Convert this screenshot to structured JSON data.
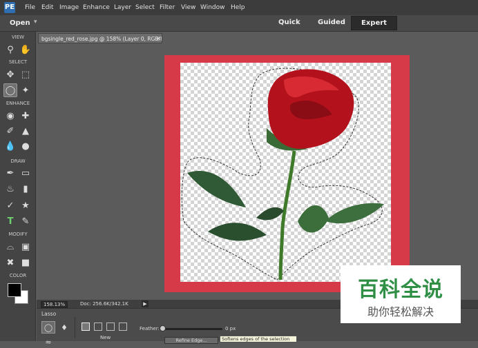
{
  "menubar": {
    "logo": "PE",
    "items": [
      "File",
      "Edit",
      "Image",
      "Enhance",
      "Layer",
      "Select",
      "Filter",
      "View",
      "Window",
      "Help"
    ]
  },
  "modebar": {
    "open_label": "Open",
    "modes": [
      "Quick",
      "Guided",
      "Expert"
    ],
    "active_mode": "Expert"
  },
  "toolbox": {
    "sections": [
      "VIEW",
      "SELECT",
      "ENHANCE",
      "DRAW",
      "MODIFY",
      "COLOR"
    ],
    "tools": {
      "zoom": "zoom-icon",
      "hand": "hand-icon",
      "move": "move-icon",
      "marquee": "marquee-icon",
      "lasso": "lasso-icon",
      "quick_select": "quick-selection-icon",
      "red_eye": "red-eye-icon",
      "spot_heal": "spot-healing-icon",
      "smart_brush": "smart-brush-icon",
      "clone": "clone-stamp-icon",
      "blur": "blur-icon",
      "sponge": "sponge-icon",
      "brush": "brush-icon",
      "eraser": "eraser-icon",
      "paint_bucket": "paint-bucket-icon",
      "gradient": "gradient-icon",
      "eyedropper": "eyedropper-icon",
      "custom_shape": "custom-shape-icon",
      "type": "type-icon",
      "pencil": "pencil-icon",
      "crop": "crop-icon",
      "recompose": "recompose-icon",
      "straighten": "straighten-icon",
      "content_move": "content-aware-move-icon"
    },
    "foreground_color": "#000000",
    "background_color": "#ffffff"
  },
  "document": {
    "tab_title": "bgsingle_red_rose.jpg @ 158% (Layer 0, RGB/8) *",
    "close_glyph": "×",
    "frame_color": "#d63a48"
  },
  "statusbar": {
    "zoom": "158.13%",
    "doc_info": "Doc: 256.6K/342.1K",
    "arrow": "▶"
  },
  "options": {
    "tool_name": "Lasso",
    "new_label": "New",
    "feather_label": "Feather:",
    "feather_value": "0 px",
    "feather_fraction": 0,
    "tooltip": "Softens edges of the selection",
    "refine_label": "Refine Edge..."
  },
  "watermark": {
    "main": "百科全说",
    "sub": "助你轻松解决",
    "color": "#2e8f45"
  }
}
